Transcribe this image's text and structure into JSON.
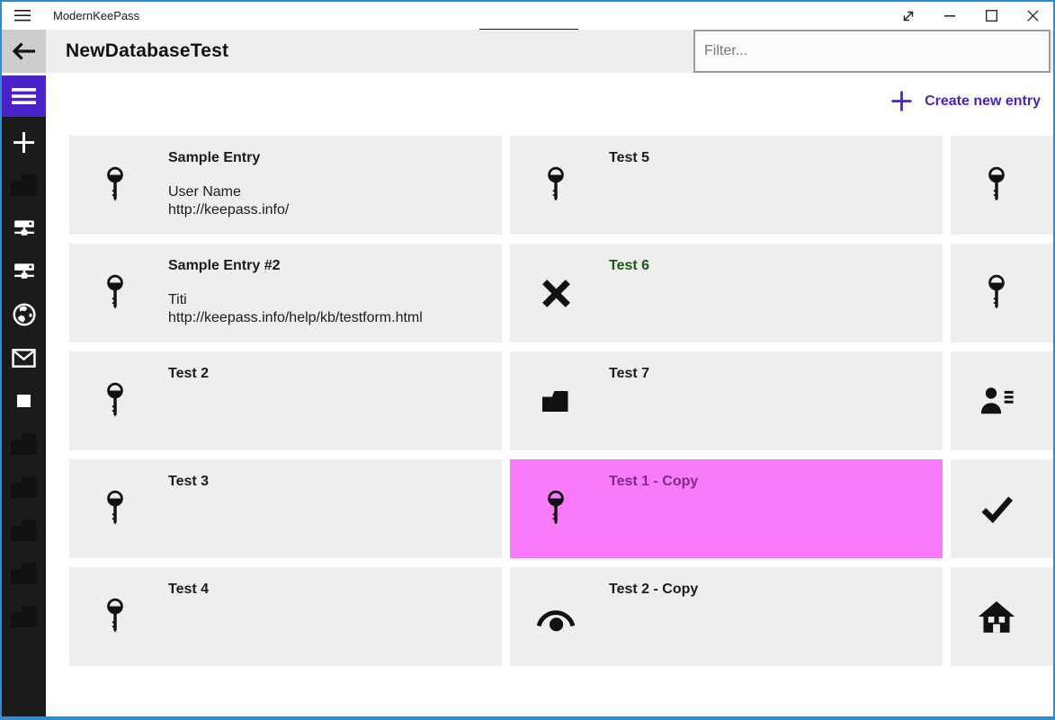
{
  "titlebar": {
    "app_title": "ModernKeePass",
    "controls": [
      {
        "name": "fullscreen-button",
        "icon": "fullscreen-icon"
      },
      {
        "name": "minimize-button",
        "icon": "minimize-icon"
      },
      {
        "name": "maximize-button",
        "icon": "maximize-icon"
      },
      {
        "name": "close-button",
        "icon": "close-icon"
      }
    ]
  },
  "header": {
    "title": "NewDatabaseTest",
    "back_icon": "arrow-left-icon",
    "filter_placeholder": "Filter..."
  },
  "actions": {
    "create_new_entry": "Create new entry",
    "icon": "plus-icon"
  },
  "colors": {
    "accent_purple": "#4b22ca",
    "window_border_blue": "#2b8dd6",
    "selected_pink": "#f97bf9",
    "selected_title_purple": "#7c2c86",
    "green_title": "#175c17",
    "sidebar_bg": "#1b1b1b",
    "card_bg": "#eeeeee"
  },
  "sidebar": {
    "toggle_icon": "hamburger-icon",
    "items": [
      {
        "icon": "plus-icon"
      },
      {
        "icon": "folder-icon"
      },
      {
        "icon": "server-icon"
      },
      {
        "icon": "server-icon"
      },
      {
        "icon": "globe-icon"
      },
      {
        "icon": "mail-icon"
      },
      {
        "icon": "square-icon"
      },
      {
        "icon": "folder-icon"
      },
      {
        "icon": "folder-icon"
      },
      {
        "icon": "folder-icon"
      },
      {
        "icon": "folder-icon"
      },
      {
        "icon": "folder-icon"
      }
    ]
  },
  "entry_grid": {
    "rows": [
      [
        {
          "title": "Sample Entry",
          "icon": "key-icon",
          "subtitle_lines": [
            "User Name",
            "http://keepass.info/"
          ]
        },
        {
          "title": "Test 5",
          "icon": "key-icon"
        },
        {
          "icon": "key-icon"
        }
      ],
      [
        {
          "title": "Sample Entry #2",
          "icon": "key-icon",
          "subtitle_lines": [
            "Titi",
            "http://keepass.info/help/kb/testform.html"
          ]
        },
        {
          "title": "Test 6",
          "icon": "cross-icon",
          "title_color": "#175c17"
        },
        {
          "icon": "key-icon"
        }
      ],
      [
        {
          "title": "Test 2",
          "icon": "key-icon"
        },
        {
          "title": "Test 7",
          "icon": "folder-icon"
        },
        {
          "icon": "person-list-icon"
        }
      ],
      [
        {
          "title": "Test 3",
          "icon": "key-icon"
        },
        {
          "title": "Test 1 - Copy",
          "icon": "key-icon",
          "selected": true,
          "title_color": "#7c2c86"
        },
        {
          "icon": "check-icon"
        }
      ],
      [
        {
          "title": "Test 4",
          "icon": "key-icon"
        },
        {
          "title": "Test 2 - Copy",
          "icon": "eye-icon"
        },
        {
          "icon": "home-icon"
        }
      ]
    ]
  }
}
